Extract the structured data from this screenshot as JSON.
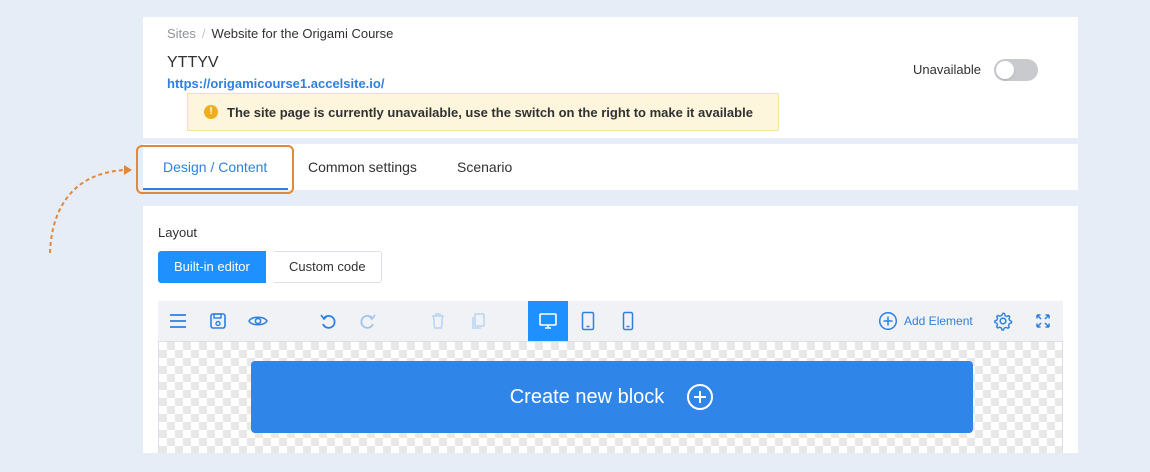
{
  "breadcrumb": {
    "root": "Sites",
    "separator": "/",
    "current": "Website for the Origami Course"
  },
  "site": {
    "title": "YTTYV",
    "url": "https://origamicourse1.accelsite.io/",
    "availability_label": "Unavailable",
    "available": false
  },
  "warning": {
    "icon": "!",
    "text": "The site page is currently unavailable, use the switch on the right to make it available"
  },
  "tabs": [
    {
      "label": "Design / Content",
      "active": true
    },
    {
      "label": "Common settings",
      "active": false
    },
    {
      "label": "Scenario",
      "active": false
    }
  ],
  "layout": {
    "label": "Layout",
    "options": [
      {
        "label": "Built-in editor",
        "active": true
      },
      {
        "label": "Custom code",
        "active": false
      }
    ]
  },
  "toolbar": {
    "icons": [
      "menu-icon",
      "save-icon",
      "preview-icon",
      "undo-icon",
      "redo-icon",
      "delete-icon",
      "copy-icon",
      "desktop-icon",
      "tablet-icon",
      "mobile-icon",
      "settings-icon",
      "fullscreen-icon"
    ],
    "add_element_label": "Add Element"
  },
  "canvas": {
    "create_block_label": "Create new block"
  },
  "colors": {
    "accent": "#2f80e0",
    "primary_button": "#1e90ff",
    "highlight_outline": "#e0893a",
    "warning_bg": "#fdf6dc",
    "warning_icon": "#f0ad1e",
    "page_bg": "#e6edf6"
  }
}
